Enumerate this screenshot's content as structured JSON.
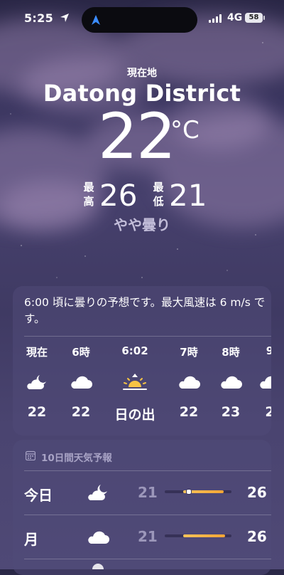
{
  "status_bar": {
    "time": "5:25",
    "network": "4G",
    "battery": "58"
  },
  "header": {
    "location_label": "現在地",
    "city": "Datong District",
    "temperature": "22",
    "unit": "°C",
    "high_label_top": "最",
    "high_label_bottom": "高",
    "high": "26",
    "low_label_top": "最",
    "low_label_bottom": "低",
    "low": "21",
    "condition": "やや曇り"
  },
  "hourly": {
    "summary": "6:00 頃に曇りの予想です。最大風速は 6 m/s です。",
    "items": [
      {
        "label": "現在",
        "icon": "cloud-moon-icon",
        "temp": "22"
      },
      {
        "label": "6時",
        "icon": "cloud-icon",
        "temp": "22"
      },
      {
        "label": "6:02",
        "icon": "sunrise-icon",
        "temp": "日の出"
      },
      {
        "label": "7時",
        "icon": "cloud-icon",
        "temp": "22"
      },
      {
        "label": "8時",
        "icon": "cloud-icon",
        "temp": "23"
      },
      {
        "label": "9",
        "icon": "cloud-icon",
        "temp": "2"
      }
    ]
  },
  "ten_day": {
    "title": "10日間天気予報",
    "days": [
      {
        "name": "今日",
        "icon": "cloud-moon-icon",
        "low": "21",
        "high": "26",
        "bar_start": 0.28,
        "bar_end": 0.88,
        "current": 0.36
      },
      {
        "name": "月",
        "icon": "cloud-icon",
        "low": "21",
        "high": "26",
        "bar_start": 0.28,
        "bar_end": 0.9
      }
    ]
  },
  "colors": {
    "background": "#3f3a63",
    "accent_bar": "#f4a534",
    "sun": "#f6c344"
  }
}
